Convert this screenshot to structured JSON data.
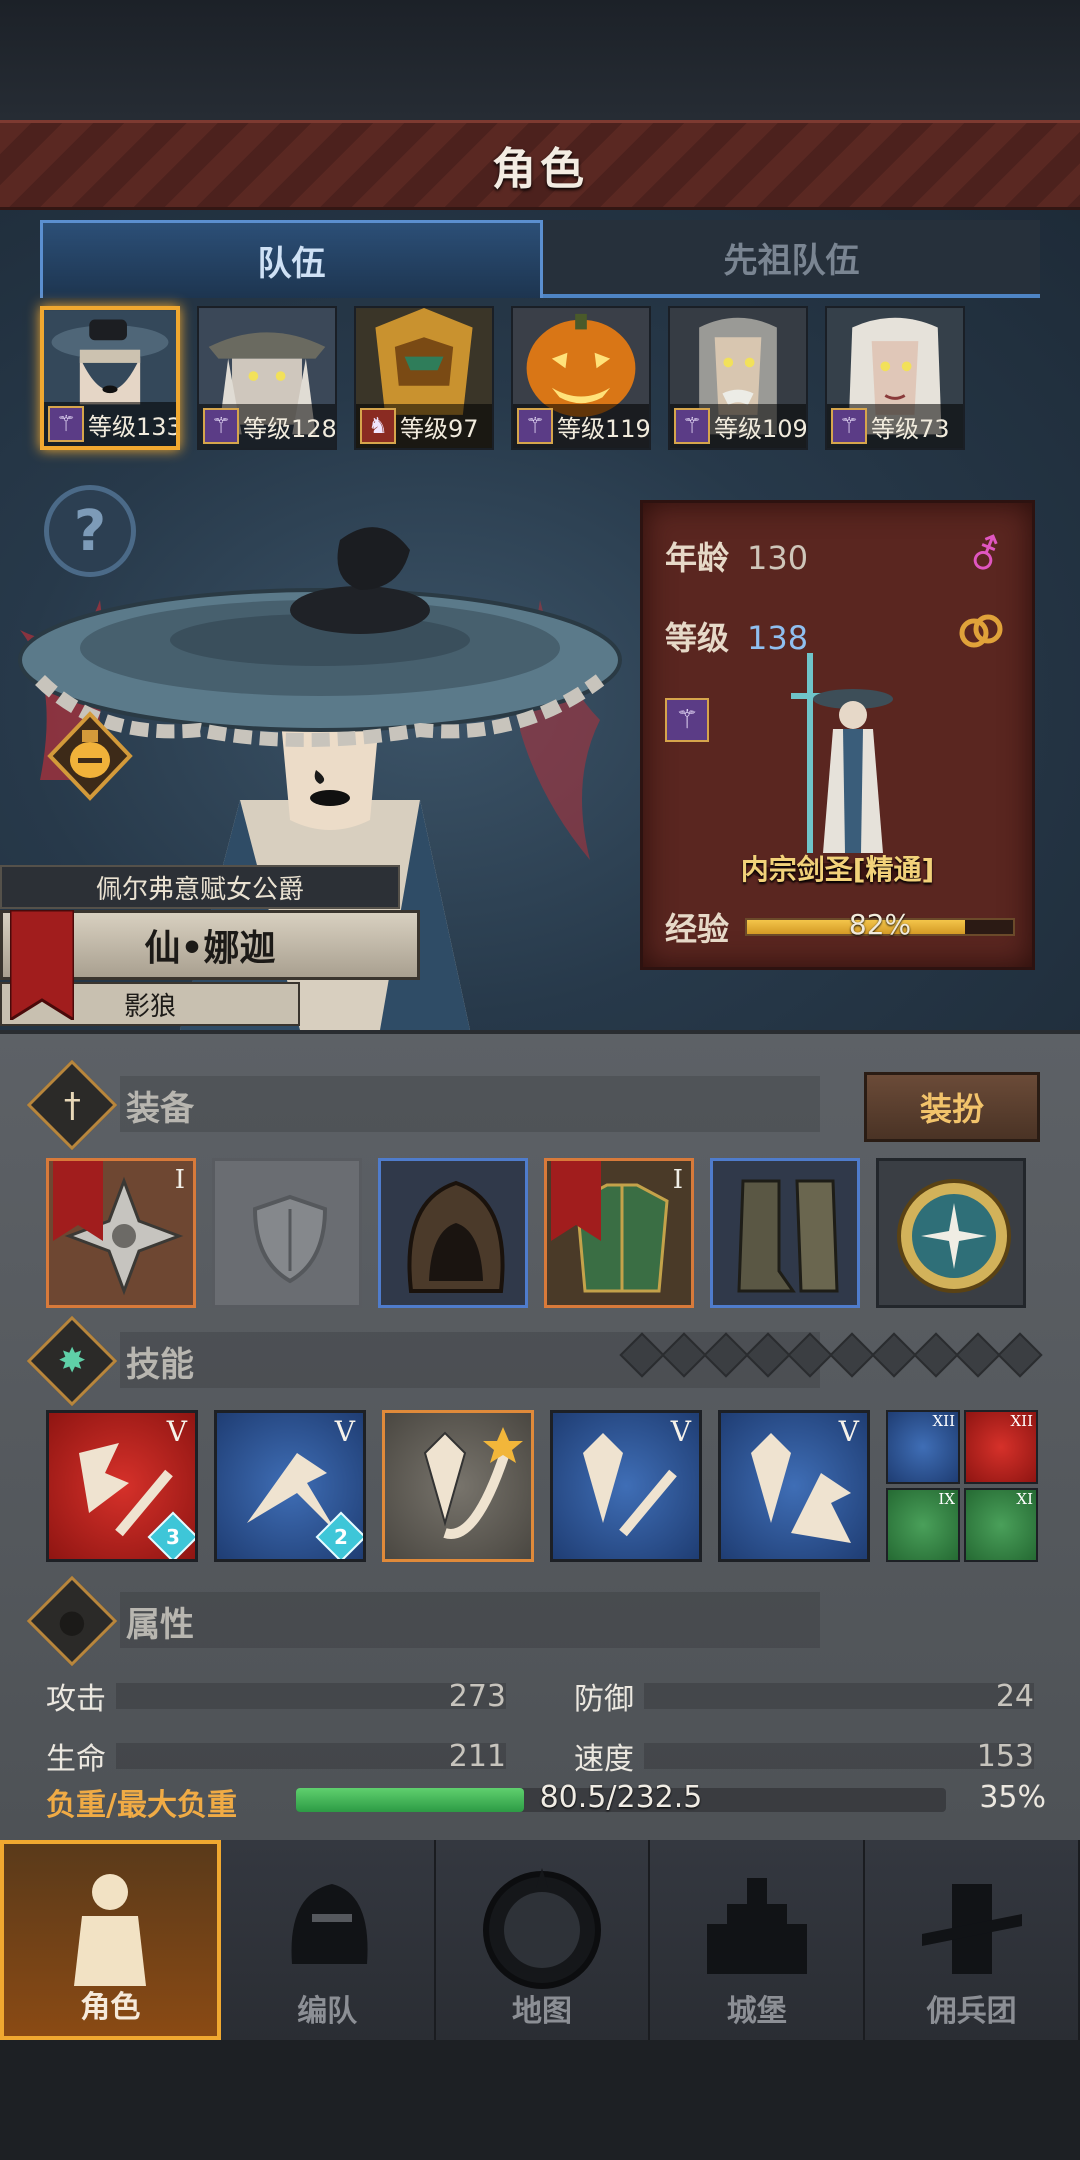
{
  "header": {
    "title": "角色"
  },
  "tabs": [
    {
      "label": "队伍"
    },
    {
      "label": "先祖队伍"
    }
  ],
  "heroes": [
    {
      "level": "等级133",
      "class_icon": "staff-icon"
    },
    {
      "level": "等级128",
      "class_icon": "staff-icon"
    },
    {
      "level": "等级97",
      "class_icon": "beast-icon"
    },
    {
      "level": "等级119",
      "class_icon": "staff-icon"
    },
    {
      "level": "等级109",
      "class_icon": "staff-icon"
    },
    {
      "level": "等级73",
      "class_icon": "staff-icon"
    }
  ],
  "character": {
    "title": "佩尔弗意赋女公爵",
    "name": "仙•娜迦",
    "subtitle": "影狼",
    "age_label": "年龄",
    "age": "130",
    "level_label": "等级",
    "level": "138",
    "gender_symbol": "⚦",
    "class_name": "内宗剑圣[精通]",
    "exp_label": "经验",
    "exp_percent": 82,
    "exp_text": "82%"
  },
  "equipment": {
    "label": "装备",
    "dress_button": "装扮",
    "slots": [
      {
        "item": "sword-guard",
        "tier": "I",
        "border": "orange"
      },
      {
        "item": "empty-shield",
        "tier": "",
        "border": "empty"
      },
      {
        "item": "hood",
        "tier": "",
        "border": "blue"
      },
      {
        "item": "armor",
        "tier": "I",
        "border": "orange"
      },
      {
        "item": "boots",
        "tier": "",
        "border": "blue"
      },
      {
        "item": "medallion",
        "tier": "",
        "border": ""
      }
    ]
  },
  "skills": {
    "label": "技能",
    "points_total": 10,
    "main": [
      {
        "tier": "V",
        "badge": "3",
        "color": "red"
      },
      {
        "tier": "V",
        "badge": "2",
        "color": "blue"
      },
      {
        "tier": "",
        "badge": "",
        "color": "grey"
      },
      {
        "tier": "V",
        "badge": "",
        "color": "blue"
      },
      {
        "tier": "V",
        "badge": "",
        "color": "blue"
      }
    ],
    "passive": [
      {
        "tier": "XII",
        "color": "blue"
      },
      {
        "tier": "XII",
        "color": "red"
      },
      {
        "tier": "IX",
        "color": "green"
      },
      {
        "tier": "XI",
        "color": "green"
      }
    ]
  },
  "attributes": {
    "label": "属性",
    "attack_label": "攻击",
    "attack": "273",
    "defense_label": "防御",
    "defense": "24",
    "hp_label": "生命",
    "hp": "211",
    "speed_label": "速度",
    "speed": "153",
    "load_label": "负重/最大负重",
    "load_text": "80.5/232.5",
    "load_percent": 35,
    "load_percent_text": "35%"
  },
  "nav": [
    {
      "label": "角色"
    },
    {
      "label": "编队"
    },
    {
      "label": "地图"
    },
    {
      "label": "城堡"
    },
    {
      "label": "佣兵团"
    }
  ],
  "colors": {
    "accent": "#f0a830",
    "panel_red": "#5a2620",
    "load_green": "#2d9b45"
  }
}
